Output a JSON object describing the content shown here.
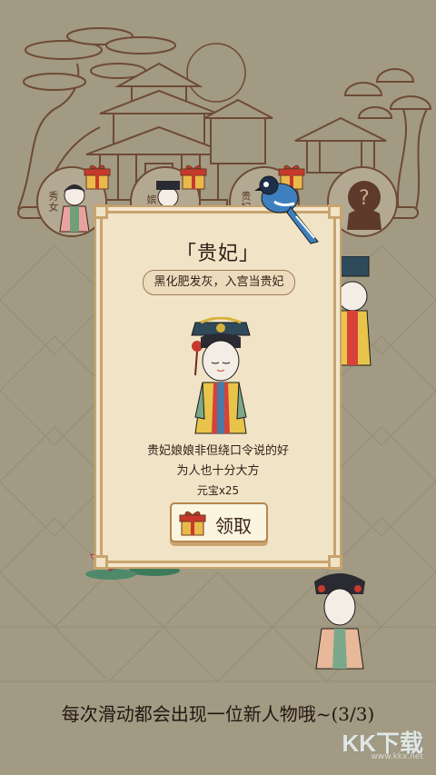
{
  "characters": [
    {
      "label": "秀女",
      "has_gift": true
    },
    {
      "label": "嫔",
      "has_gift": true
    },
    {
      "label": "贵妃",
      "has_gift": true
    },
    {
      "label": "?",
      "locked": true
    }
  ],
  "modal": {
    "title": "「贵妃」",
    "subtitle": "黑化肥发灰，入宫当贵妃",
    "description_line1": "贵妃娘娘非但绕口令说的好",
    "description_line2": "为人也十分大方",
    "reward": "元宝x25",
    "claim_label": "领取"
  },
  "footer": {
    "progress_text": "每次滑动都会出现一位新人物哦~(3/3)"
  },
  "watermark": {
    "brand": "KK下载",
    "url": "www.kkx.net"
  },
  "colors": {
    "background": "#a29a82",
    "line_art": "#6e4a35",
    "modal_fill": "#f1e4c6",
    "modal_border": "#c9a46e",
    "gift_red": "#c6392c",
    "gift_gold": "#e9b94a"
  }
}
